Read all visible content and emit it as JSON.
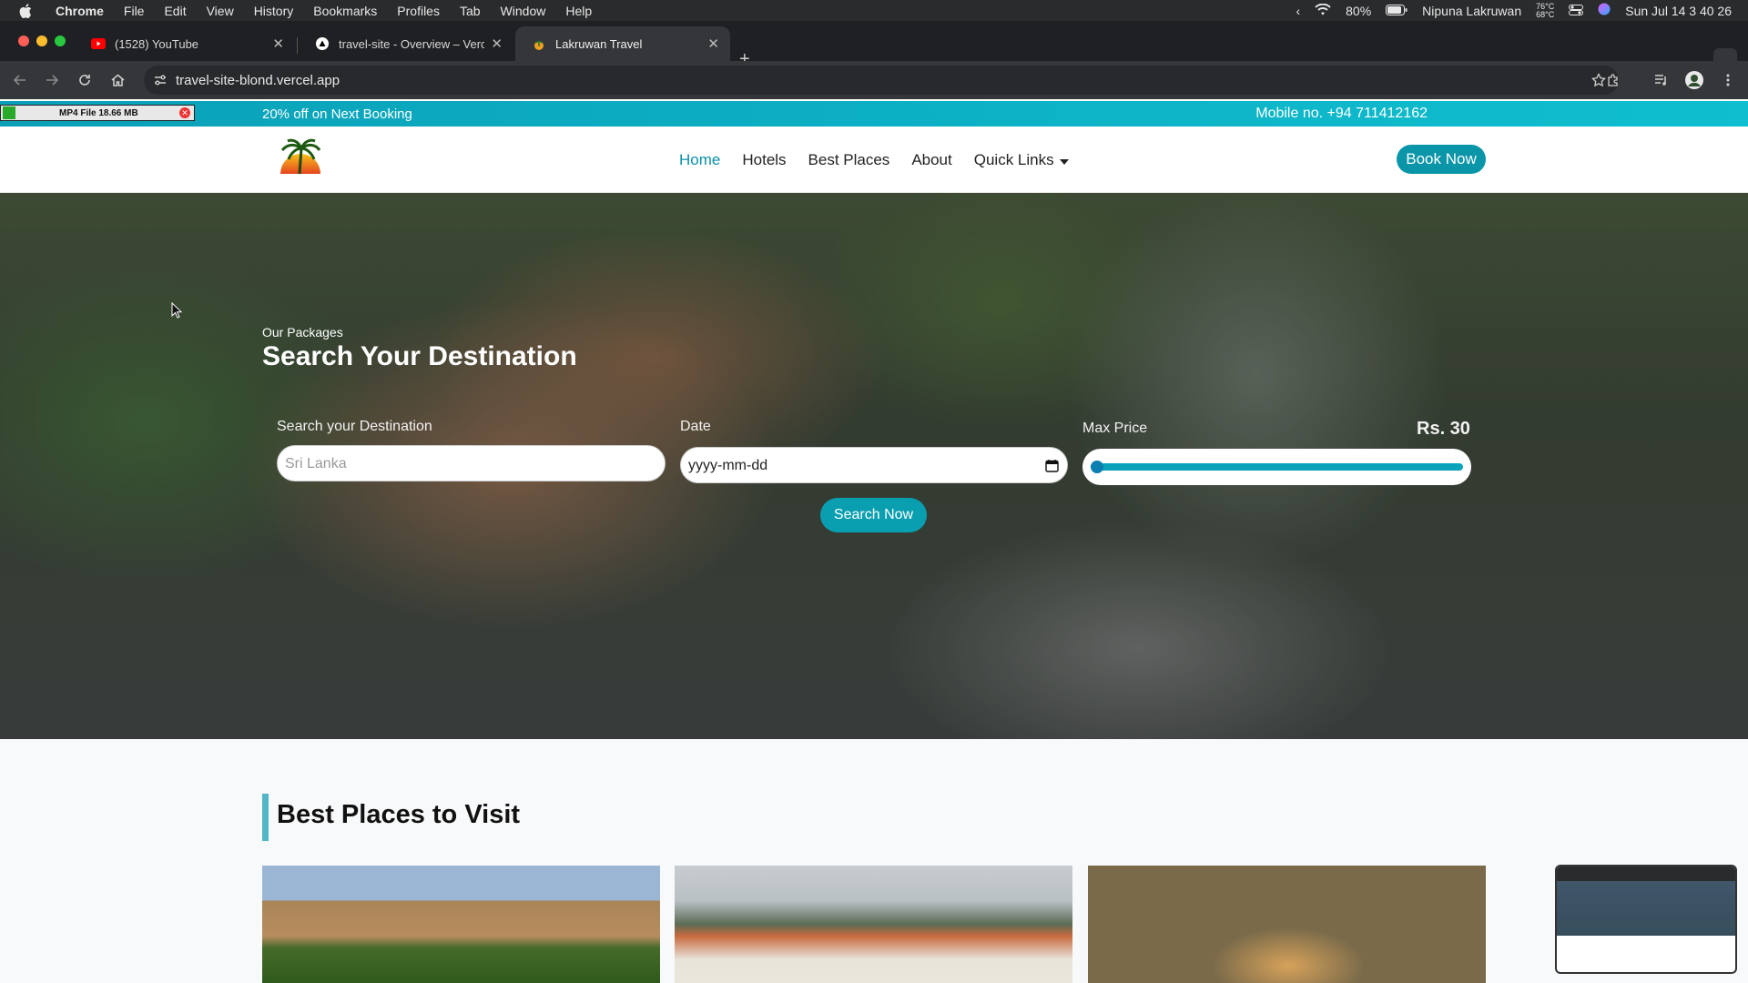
{
  "menubar": {
    "items": [
      "Chrome",
      "File",
      "Edit",
      "View",
      "History",
      "Bookmarks",
      "Profiles",
      "Tab",
      "Window",
      "Help"
    ],
    "battery": "80%",
    "user": "Nipuna Lakruwan",
    "temp_cpu": "76°C",
    "temp_gpu": "68°C",
    "datetime": "Sun Jul 14  3 40 26"
  },
  "tabs": [
    {
      "title": "(1528) YouTube",
      "icon": "youtube-icon"
    },
    {
      "title": "travel-site - Overview – Vercel",
      "icon": "vercel-icon"
    },
    {
      "title": "Lakruwan Travel",
      "icon": "site-icon"
    }
  ],
  "toolbar": {
    "url": "travel-site-blond.vercel.app"
  },
  "download_chip": {
    "label": "MP4 File 18.66 MB"
  },
  "promo": {
    "left": "20% off on Next Booking",
    "right": "Mobile no. +94 711412162"
  },
  "nav": {
    "links": [
      "Home",
      "Hotels",
      "Best Places",
      "About",
      "Quick Links"
    ],
    "book_button": "Book Now"
  },
  "hero": {
    "subtitle": "Our Packages",
    "title": "Search Your Destination",
    "dest_label": "Search your Destination",
    "dest_placeholder": "Sri Lanka",
    "date_label": "Date",
    "date_value": "yyyy-mm-dd",
    "price_label": "Max Price",
    "price_value": "Rs. 30",
    "slider_fraction": 0.0,
    "search_button": "Search Now"
  },
  "best_places": {
    "title": "Best Places to Visit",
    "cards": [
      "sigiriya-image",
      "temple-image",
      "leopard-image"
    ]
  }
}
